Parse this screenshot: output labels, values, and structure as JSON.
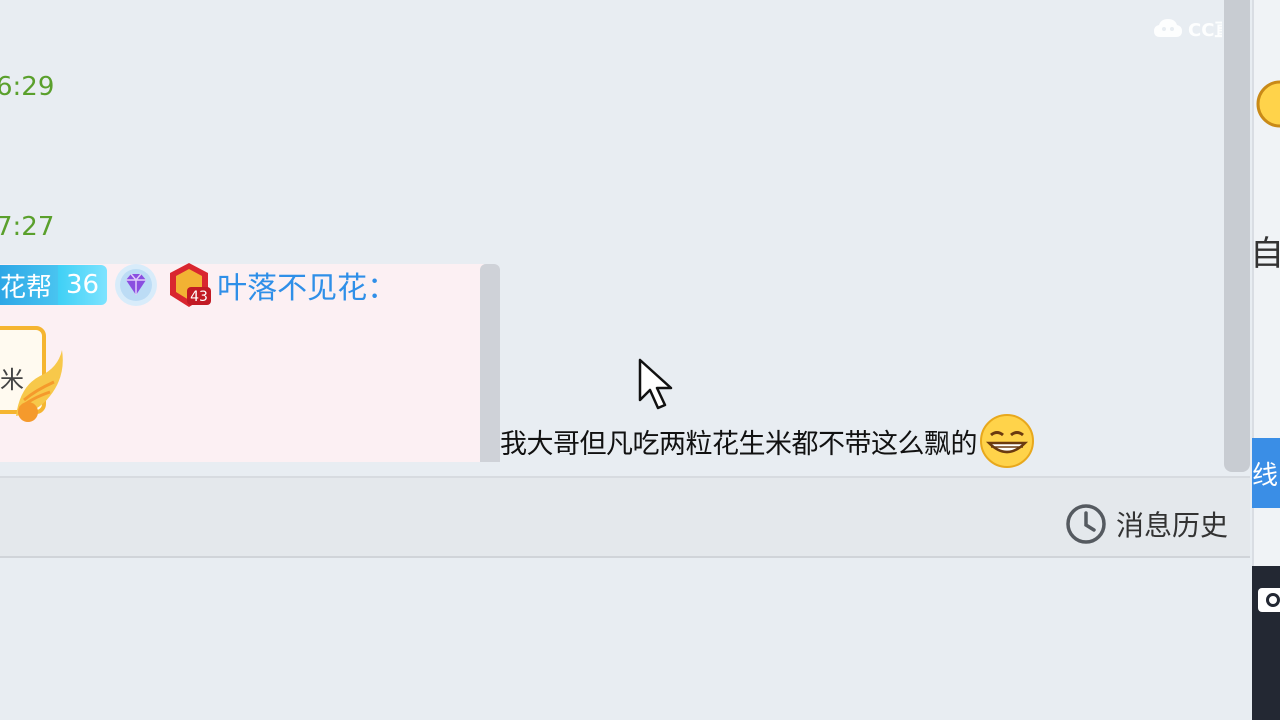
{
  "watermark": {
    "brand": "CC直播"
  },
  "chat": {
    "timestamps": [
      "6:29",
      "7:27"
    ],
    "message": {
      "fan_badge_name": "花帮",
      "fan_badge_level": "36",
      "user_level": "43",
      "username": "叶落不见花：",
      "gift_char": "米",
      "text": "我大哥但凡吃两粒花生米都不带这么飘的",
      "emoji": "grin-emoji"
    }
  },
  "footer": {
    "history_label": "消息历史",
    "history_icon": "clock-icon"
  },
  "side_panel": {
    "text_fragment": "自",
    "button_fragment": "线"
  },
  "colors": {
    "timestamp": "#5aa02c",
    "username": "#2f8fe8",
    "accent": "#3a8ee6",
    "bubble_bg": "#fcf0f3"
  }
}
